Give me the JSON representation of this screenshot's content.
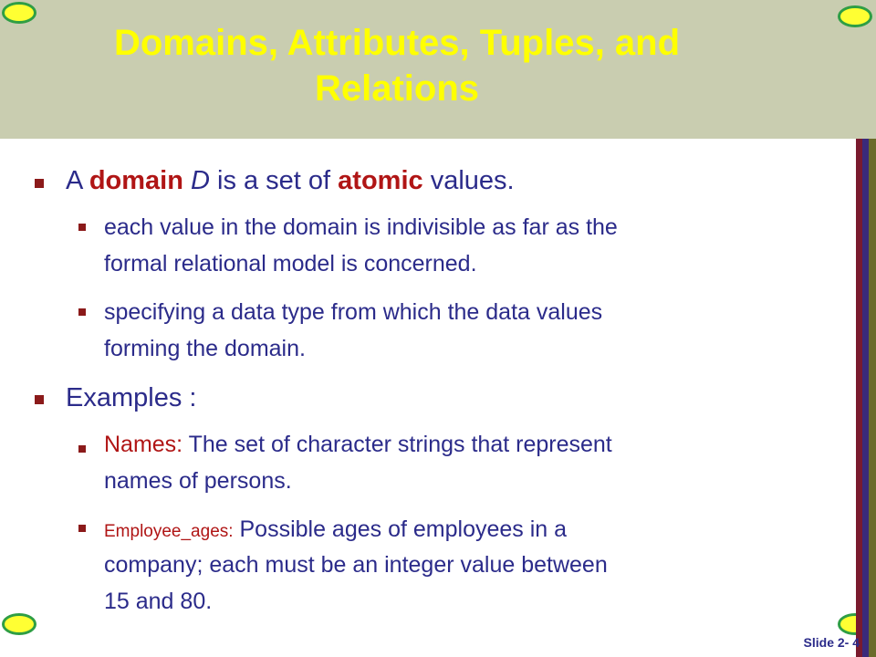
{
  "slide": {
    "title_line1": "Domains, Attributes, Tuples, and",
    "title_line2": "Relations",
    "footer": "Slide 2- 4"
  },
  "bullets": {
    "b1": {
      "pre": "A ",
      "domain": "domain",
      "d": " D",
      "mid": " is a set of ",
      "atomic": "atomic",
      "post": " values."
    },
    "b1_1": {
      "line1": "each value in the domain is indivisible as far as the",
      "line2": "formal relational model is concerned."
    },
    "b1_2": {
      "line1": "specifying a data type from which the data values",
      "line2": "forming the domain."
    },
    "b2": {
      "text": "Examples :"
    },
    "b2_1": {
      "label": "Names:",
      "line1": " The set of character strings that represent",
      "line2": "names of persons."
    },
    "b2_2": {
      "label": "Employee_ages:",
      "line1": " Possible ages of employees in a",
      "line2": "company; each must be an integer value between",
      "line3": "15 and 80."
    }
  },
  "colors": {
    "title": "#ffff00",
    "title_band": "#c9cdb0",
    "body_text": "#2b2b8a",
    "highlight": "#b01515",
    "bullet": "#8b1a1a",
    "stripes": [
      "#7a1a2e",
      "#3a2a7a",
      "#6b6b2a"
    ]
  }
}
